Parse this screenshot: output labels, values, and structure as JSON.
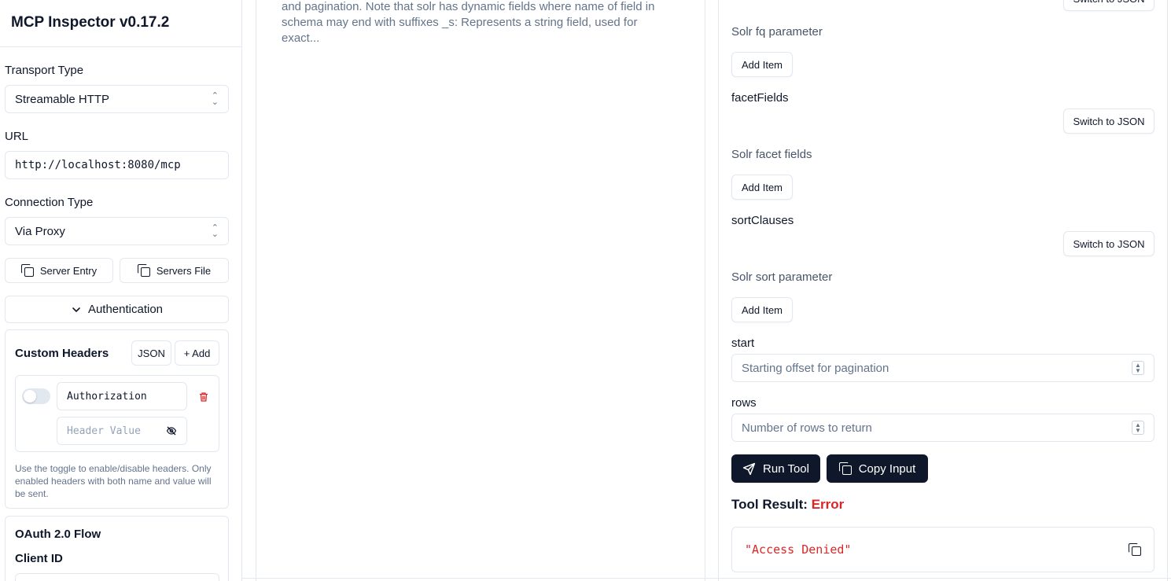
{
  "app": {
    "title": "MCP Inspector v0.17.2"
  },
  "sidebar": {
    "transport_label": "Transport Type",
    "transport_value": "Streamable HTTP",
    "url_label": "URL",
    "url_value": "http://localhost:8080/mcp",
    "connection_label": "Connection Type",
    "connection_value": "Via Proxy",
    "server_entry_label": "Server Entry",
    "servers_file_label": "Servers File",
    "auth_label": "Authentication",
    "custom_headers": {
      "title": "Custom Headers",
      "json_label": "JSON",
      "add_label": "+ Add",
      "header_name": "Authorization",
      "header_value_placeholder": "Header Value",
      "enabled": false,
      "help": "Use the toggle to enable/disable headers. Only enabled headers with both name and value will be sent."
    },
    "oauth": {
      "title": "OAuth 2.0 Flow",
      "client_id_label": "Client ID"
    }
  },
  "middle": {
    "description": "and pagination. Note that solr has dynamic fields where name of field in schema may end with suffixes _s: Represents a string field, used for exact..."
  },
  "right": {
    "switch_json_label": "Switch to JSON",
    "fq_desc": "Solr fq parameter",
    "add_item_label": "Add Item",
    "facet_label": "facetFields",
    "facet_desc": "Solr facet fields",
    "sort_label": "sortClauses",
    "sort_desc": "Solr sort parameter",
    "start_label": "start",
    "start_placeholder": "Starting offset for pagination",
    "rows_label": "rows",
    "rows_placeholder": "Number of rows to return",
    "run_tool_label": "Run Tool",
    "copy_input_label": "Copy Input",
    "result_label": "Tool Result:",
    "result_status": "Error",
    "result_text": "\"Access Denied\""
  },
  "colors": {
    "primary_dark": "#0f172a",
    "error": "#dc2626",
    "border": "#e2e8f0",
    "muted": "#64748b"
  }
}
